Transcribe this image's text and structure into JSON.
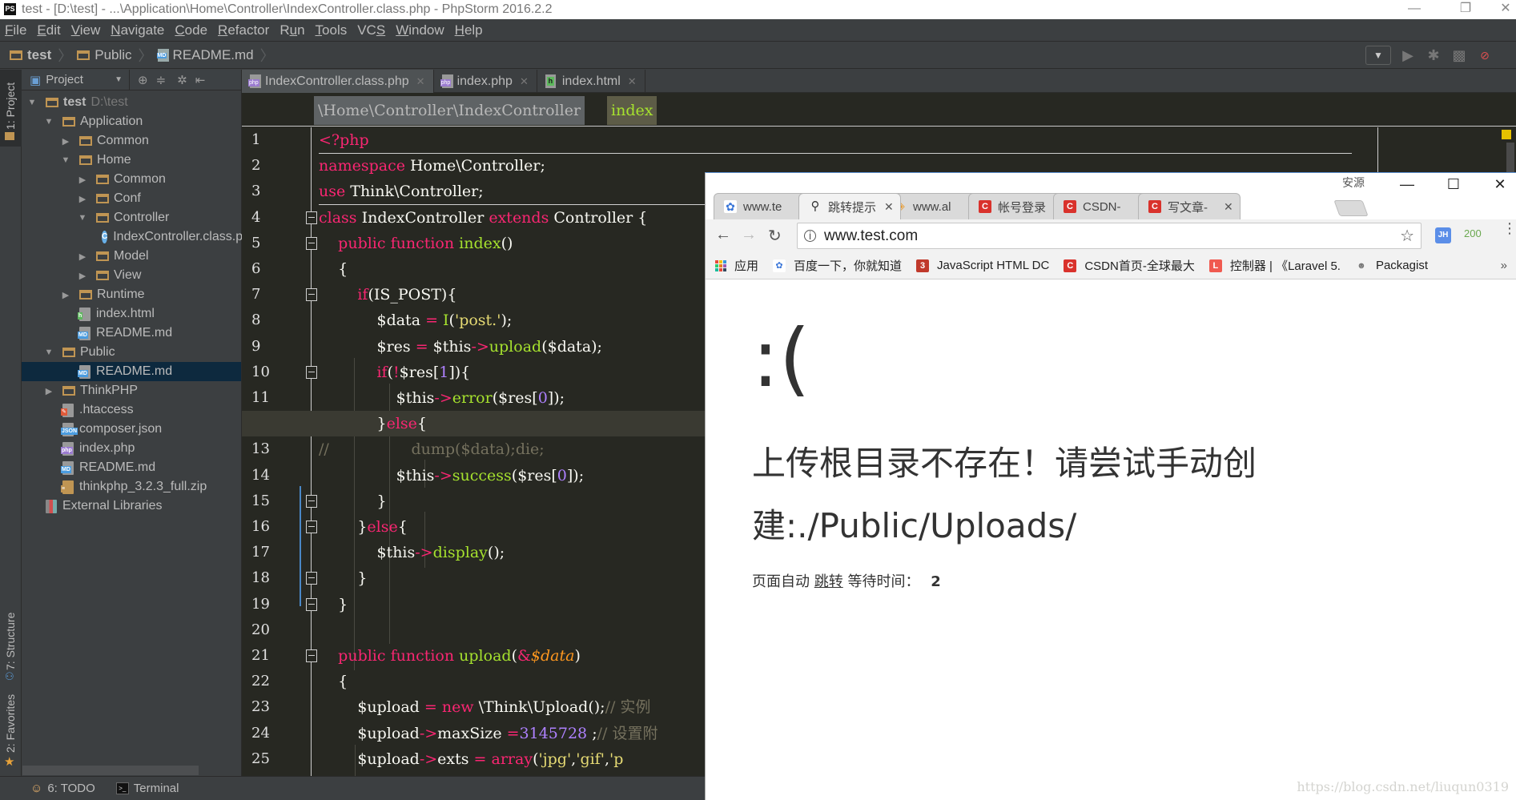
{
  "window": {
    "title": "test - [D:\\test] - ...\\Application\\Home\\Controller\\IndexController.class.php - PhpStorm 2016.2.2",
    "logo": "PS",
    "controls": {
      "minimize": "—",
      "restore": "❐",
      "close": "✕"
    }
  },
  "menu": [
    {
      "label": "File",
      "mnemonic": "F"
    },
    {
      "label": "Edit",
      "mnemonic": "E"
    },
    {
      "label": "View",
      "mnemonic": "V"
    },
    {
      "label": "Navigate",
      "mnemonic": "N"
    },
    {
      "label": "Code",
      "mnemonic": "C"
    },
    {
      "label": "Refactor",
      "mnemonic": "R"
    },
    {
      "label": "Run",
      "mnemonic": "u"
    },
    {
      "label": "Tools",
      "mnemonic": "T"
    },
    {
      "label": "VCS",
      "mnemonic": "S"
    },
    {
      "label": "Window",
      "mnemonic": "W"
    },
    {
      "label": "Help",
      "mnemonic": "H"
    }
  ],
  "navbar": {
    "crumbs": [
      "test",
      "Public",
      "README.md"
    ],
    "run_select": "▼",
    "tools": [
      "run-icon",
      "debug-icon",
      "coverage-icon",
      "stop-debug-icon"
    ]
  },
  "side_tabs": {
    "project": "1: Project",
    "structure": "7: Structure",
    "favorites": "2: Favorites"
  },
  "project_panel": {
    "title": "Project",
    "tree": [
      {
        "label": "test",
        "hint": "D:\\test",
        "depth": 0,
        "type": "folder",
        "expanded": true,
        "bold": true
      },
      {
        "label": "Application",
        "depth": 1,
        "type": "folder",
        "expanded": true
      },
      {
        "label": "Common",
        "depth": 2,
        "type": "folder",
        "expanded": false
      },
      {
        "label": "Home",
        "depth": 2,
        "type": "folder",
        "expanded": true
      },
      {
        "label": "Common",
        "depth": 3,
        "type": "folder",
        "expanded": false
      },
      {
        "label": "Conf",
        "depth": 3,
        "type": "folder",
        "expanded": false
      },
      {
        "label": "Controller",
        "depth": 3,
        "type": "folder",
        "expanded": true
      },
      {
        "label": "IndexController.class.php",
        "depth": 4,
        "type": "class"
      },
      {
        "label": "Model",
        "depth": 3,
        "type": "folder",
        "expanded": false
      },
      {
        "label": "View",
        "depth": 3,
        "type": "folder",
        "expanded": false
      },
      {
        "label": "Runtime",
        "depth": 2,
        "type": "folder",
        "expanded": false
      },
      {
        "label": "index.html",
        "depth": 2,
        "type": "html"
      },
      {
        "label": "README.md",
        "depth": 2,
        "type": "md"
      },
      {
        "label": "Public",
        "depth": 1,
        "type": "folder",
        "expanded": true
      },
      {
        "label": "README.md",
        "depth": 2,
        "type": "md",
        "selected": true
      },
      {
        "label": "ThinkPHP",
        "depth": 1,
        "type": "folder",
        "expanded": false
      },
      {
        "label": ".htaccess",
        "depth": 1,
        "type": "htaccess"
      },
      {
        "label": "composer.json",
        "depth": 1,
        "type": "json"
      },
      {
        "label": "index.php",
        "depth": 1,
        "type": "php"
      },
      {
        "label": "README.md",
        "depth": 1,
        "type": "md"
      },
      {
        "label": "thinkphp_3.2.3_full.zip",
        "depth": 1,
        "type": "zip"
      },
      {
        "label": "External Libraries",
        "depth": 0,
        "type": "libs"
      }
    ]
  },
  "editor": {
    "tabs": [
      {
        "label": "IndexController.class.php",
        "type": "php",
        "active": true
      },
      {
        "label": "index.php",
        "type": "php",
        "active": false
      },
      {
        "label": "index.html",
        "type": "html",
        "active": false
      }
    ],
    "breadcrumb": {
      "class": "\\Home\\Controller\\IndexController",
      "method": "index"
    },
    "current_line": 12,
    "lines": [
      {
        "n": "1",
        "html": "<span class=\"php-tag\">&lt;?php</span>"
      },
      {
        "n": "2",
        "html": "<span class=\"kw\">namespace</span> Home\\Controller;"
      },
      {
        "n": "3",
        "html": "<span class=\"kw\">use</span> Think\\Controller;"
      },
      {
        "n": "4",
        "html": "<span class=\"kw\">class</span> IndexController <span class=\"kw\">extends</span> Controller {"
      },
      {
        "n": "5",
        "html": "    <span class=\"kw\">public function</span> <span class=\"fn\">index</span>()"
      },
      {
        "n": "6",
        "html": "    {"
      },
      {
        "n": "7",
        "html": "        <span class=\"kw\">if</span>(IS_POST){"
      },
      {
        "n": "8",
        "html": "            $data <span class=\"kw\">=</span> <span class=\"fn\">I</span>(<span class=\"str\">'post.'</span>);"
      },
      {
        "n": "9",
        "html": "            $res <span class=\"kw\">=</span> $this<span class=\"kw\">-&gt;</span><span class=\"fn\">upload</span>($data);"
      },
      {
        "n": "10",
        "html": "            <span class=\"kw\">if</span>(<span class=\"kw\">!</span>$res[<span class=\"num\">1</span>]){"
      },
      {
        "n": "11",
        "html": "                $this<span class=\"kw\">-&gt;</span><span class=\"fn\">error</span>($res[<span class=\"num\">0</span>]);"
      },
      {
        "n": "12",
        "html": "            }<span class=\"kw\">else</span>{"
      },
      {
        "n": "13",
        "html": "<span class=\"cm\">//                 dump($data);die;</span>"
      },
      {
        "n": "14",
        "html": "                $this<span class=\"kw\">-&gt;</span><span class=\"fn\">success</span>($res[<span class=\"num\">0</span>]);"
      },
      {
        "n": "15",
        "html": "            }"
      },
      {
        "n": "16",
        "html": "        }<span class=\"kw\">else</span>{"
      },
      {
        "n": "17",
        "html": "            $this<span class=\"kw\">-&gt;</span><span class=\"fn\">display</span>();"
      },
      {
        "n": "18",
        "html": "        }"
      },
      {
        "n": "19",
        "html": "    }"
      },
      {
        "n": "20",
        "html": ""
      },
      {
        "n": "21",
        "html": "    <span class=\"kw\">public function</span> <span class=\"fn\">upload</span>(<span class=\"kw\">&amp;</span><span class=\"var-it\">$data</span>)"
      },
      {
        "n": "22",
        "html": "    {"
      },
      {
        "n": "23",
        "html": "        $upload <span class=\"kw\">=</span> <span class=\"kw\">new</span> \\Think\\Upload();<span class=\"cm\">// 实例</span>"
      },
      {
        "n": "24",
        "html": "        $upload<span class=\"kw\">-&gt;</span>maxSize <span class=\"kw\">=</span><span class=\"num\">3145728</span> ;<span class=\"cm\">// 设置附</span>"
      },
      {
        "n": "25",
        "html": "        $upload<span class=\"kw\">-&gt;</span>exts <span class=\"kw\">=</span> <span class=\"kw\">array</span>(<span class=\"str\">'jpg'</span>,<span class=\"str\">'gif'</span>,<span class=\"str\">'p</span>"
      }
    ]
  },
  "bottom_bar": {
    "todo": "6: TODO",
    "terminal": "Terminal"
  },
  "browser": {
    "user": "安源",
    "tabs": [
      {
        "label": "www.te",
        "favicon": "baidu",
        "active": false
      },
      {
        "label": "跳转提示",
        "favicon": "pin",
        "active": true
      },
      {
        "label": "www.al",
        "favicon": "aliyun",
        "active": false
      },
      {
        "label": "帐号登录",
        "favicon": "csdn",
        "active": false
      },
      {
        "label": "CSDN-",
        "favicon": "csdn",
        "active": false
      },
      {
        "label": "写文章-",
        "favicon": "csdn",
        "active": false
      }
    ],
    "url": "www.test.com",
    "extensions": {
      "jh": "JH",
      "status": "200"
    },
    "bookmarks": [
      {
        "label": "应用",
        "favicon": "apps"
      },
      {
        "label": "百度一下，你就知道",
        "favicon": "baidu"
      },
      {
        "label": "JavaScript HTML DC",
        "favicon": "js"
      },
      {
        "label": "CSDN首页-全球最大",
        "favicon": "csdn"
      },
      {
        "label": "控制器 | 《Laravel 5.",
        "favicon": "laravel"
      },
      {
        "label": "Packagist",
        "favicon": "packagist"
      }
    ],
    "bookmarks_more": "»",
    "page": {
      "face": ":(",
      "message": "上传根目录不存在！请尝试手动创建:./Public/Uploads/",
      "jump_prefix": "页面自动",
      "jump_link": "跳转",
      "wait_label": "等待时间：",
      "wait_seconds": "2"
    }
  },
  "watermark": "https://blog.csdn.net/liuqun0319"
}
